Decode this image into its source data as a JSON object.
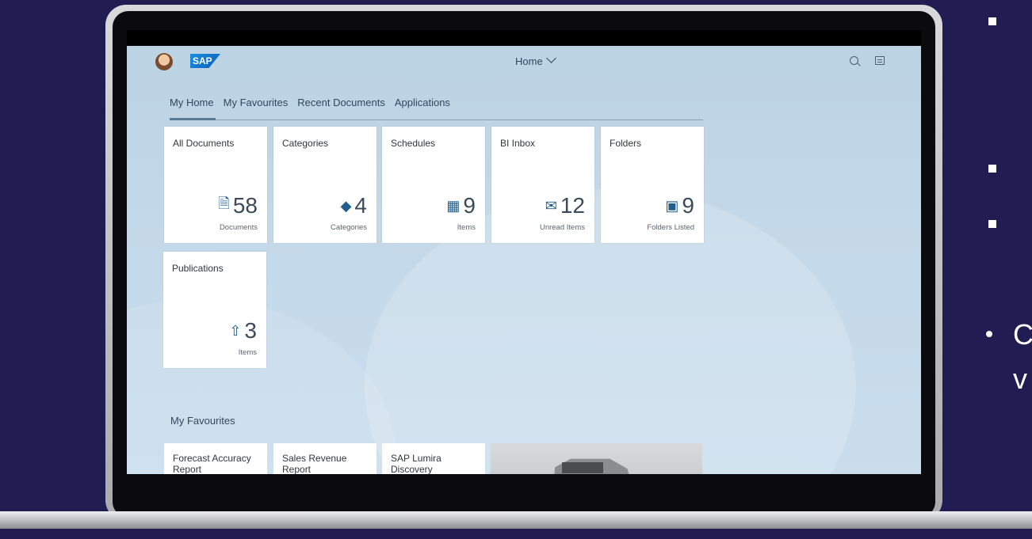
{
  "shell": {
    "title": "Home",
    "logo_text": "SAP"
  },
  "tabs": [
    "My Home",
    "My Favourites",
    "Recent Documents",
    "Applications"
  ],
  "tiles": [
    {
      "title": "All Documents",
      "icon": "document-icon",
      "glyph": "🗎",
      "count": "58",
      "unit": "Documents"
    },
    {
      "title": "Categories",
      "icon": "categories-icon",
      "glyph": "◆",
      "count": "4",
      "unit": "Categories"
    },
    {
      "title": "Schedules",
      "icon": "calendar-icon",
      "glyph": "▦",
      "count": "9",
      "unit": "Items"
    },
    {
      "title": "BI Inbox",
      "icon": "envelope-icon",
      "glyph": "✉",
      "count": "12",
      "unit": "Unread Items"
    },
    {
      "title": "Folders",
      "icon": "folder-icon",
      "glyph": "▣",
      "count": "9",
      "unit": "Folders Listed"
    },
    {
      "title": "Publications",
      "icon": "share-icon",
      "glyph": "⇧",
      "count": "3",
      "unit": "Items"
    }
  ],
  "favourites": {
    "title": "My Favourites",
    "items": [
      "Forecast Accuracy Report",
      "Sales Revenue Report",
      "SAP Lumira Discovery"
    ]
  },
  "edge_text": {
    "line1": "C",
    "line2": "v"
  }
}
